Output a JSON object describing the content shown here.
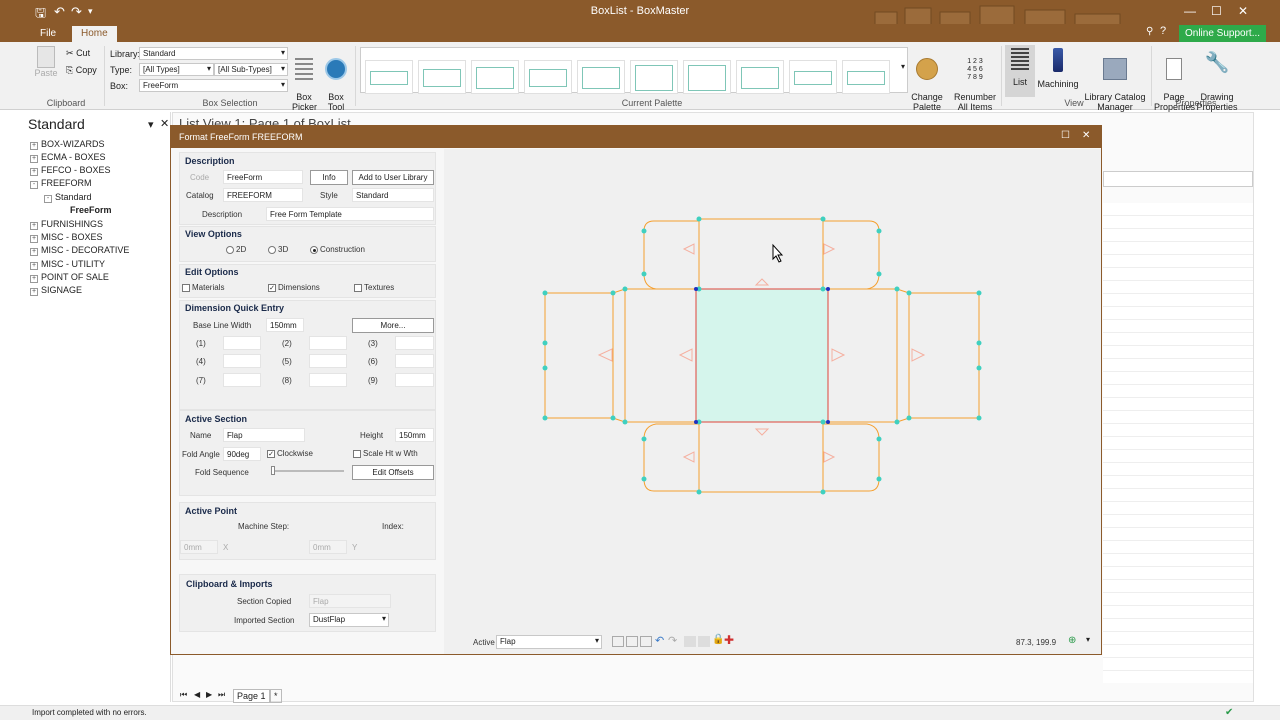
{
  "app": {
    "title": "BoxList - BoxMaster",
    "online_support": "Online Support..."
  },
  "tabs": {
    "file": "File",
    "home": "Home"
  },
  "clipboard": {
    "paste": "Paste",
    "cut": "Cut",
    "copy": "Copy",
    "label": "Clipboard"
  },
  "box_selection": {
    "library_label": "Library:",
    "library_value": "Standard",
    "type_label": "Type:",
    "type_value": "[All Types]",
    "subtype_value": "[All Sub-Types]",
    "box_label": "Box:",
    "box_value": "FreeForm",
    "box_picker": "Box\nPicker",
    "box_tool": "Box\nTool",
    "label": "Box Selection"
  },
  "palette": {
    "label": "Current Palette",
    "change": "Change\nPalette ▾",
    "renumber": "Renumber\nAll Items"
  },
  "view": {
    "list": "List",
    "machining": "Machining",
    "library_catalog": "Library Catalog\nManager",
    "label": "View"
  },
  "properties": {
    "page": "Page\nProperties",
    "drawing": "Drawing\nProperties",
    "label": "Properties"
  },
  "left_panel": {
    "title": "Standard",
    "items": [
      {
        "label": "BOX-WIZARDS",
        "exp": "+"
      },
      {
        "label": "ECMA - BOXES",
        "exp": "+"
      },
      {
        "label": "FEFCO - BOXES",
        "exp": "+"
      },
      {
        "label": "FREEFORM",
        "exp": "-"
      },
      {
        "label": "Standard",
        "exp": "-"
      },
      {
        "label": "FreeForm",
        "exp": ""
      },
      {
        "label": "FURNISHINGS",
        "exp": "+"
      },
      {
        "label": "MISC - BOXES",
        "exp": "+"
      },
      {
        "label": "MISC - DECORATIVE",
        "exp": "+"
      },
      {
        "label": "MISC - UTILITY",
        "exp": "+"
      },
      {
        "label": "POINT OF SALE",
        "exp": "+"
      },
      {
        "label": "SIGNAGE",
        "exp": "+"
      }
    ]
  },
  "list_view_title": "List View 1: Page 1 of BoxList",
  "dialog": {
    "title": "Format FreeForm FREEFORM",
    "description": {
      "heading": "Description",
      "code_label": "Code",
      "code_value": "FreeForm",
      "info": "Info",
      "add_user_lib": "Add to User Library",
      "catalog_label": "Catalog",
      "catalog_value": "FREEFORM",
      "style_label": "Style",
      "style_value": "Standard",
      "desc_label": "Description",
      "desc_value": "Free Form Template"
    },
    "view_options": {
      "heading": "View Options",
      "opt_2d": "2D",
      "opt_3d": "3D",
      "opt_construction": "Construction"
    },
    "edit_options": {
      "heading": "Edit Options",
      "materials": "Materials",
      "dimensions": "Dimensions",
      "textures": "Textures"
    },
    "dqe": {
      "heading": "Dimension Quick Entry",
      "baseline_label": "Base Line Width",
      "baseline_value": "150mm",
      "more": "More...",
      "slots": [
        "(1)",
        "(2)",
        "(3)",
        "(4)",
        "(5)",
        "(6)",
        "(7)",
        "(8)",
        "(9)"
      ]
    },
    "active_section": {
      "heading": "Active Section",
      "name_label": "Name",
      "name_value": "Flap",
      "height_label": "Height",
      "height_value": "150mm",
      "fold_angle_label": "Fold Angle",
      "fold_angle_value": "90deg",
      "clockwise": "Clockwise",
      "scale": "Scale Ht w Wth",
      "fold_seq_label": "Fold Sequence",
      "edit_offsets": "Edit Offsets"
    },
    "active_point": {
      "heading": "Active Point",
      "machine_step": "Machine Step:",
      "index": "Index:",
      "x_value": "0mm",
      "x_label": "X",
      "y_value": "0mm",
      "y_label": "Y"
    },
    "clipboard_imports": {
      "heading": "Clipboard & Imports",
      "section_copied_label": "Section Copied",
      "section_copied_value": "Flap",
      "imported_label": "Imported Section",
      "imported_value": "DustFlap"
    },
    "footer": {
      "active_label": "Active",
      "active_value": "Flap",
      "coords": "87.3, 199.9"
    }
  },
  "page_tab": "Page 1",
  "status": {
    "message": "Import completed with no errors."
  }
}
